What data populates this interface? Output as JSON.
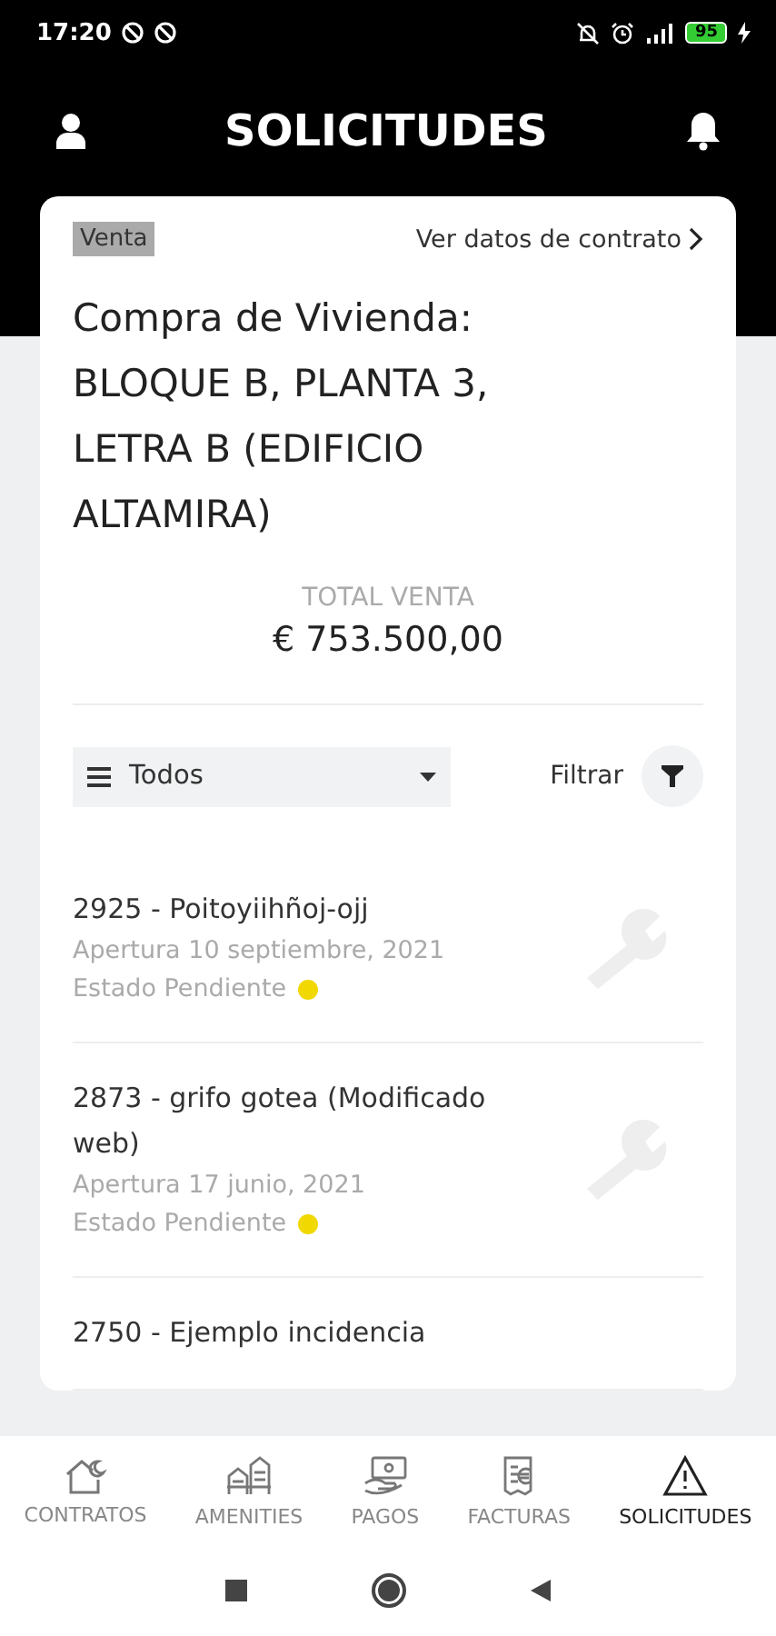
{
  "status_bar": {
    "time": "17:20",
    "battery": "95"
  },
  "header": {
    "title": "SOLICITUDES"
  },
  "contract": {
    "tag": "Venta",
    "link": "Ver datos de contrato",
    "title": "Compra de Vivienda: BLOQUE B, PLANTA 3, LETRA B (EDIFICIO ALTAMIRA)",
    "total_label": "TOTAL VENTA",
    "total": "€ 753.500,00"
  },
  "filter": {
    "dropdown": "Todos",
    "button": "Filtrar"
  },
  "requests": [
    {
      "title": "2925 - Poitoyiihñoj-ojj",
      "opened": "Apertura 10 septiembre, 2021",
      "status": "Estado Pendiente",
      "color": "#f0d800"
    },
    {
      "title": "2873 - grifo gotea (Modificado web)",
      "opened": "Apertura 17 junio, 2021",
      "status": "Estado Pendiente",
      "color": "#f0d800"
    },
    {
      "title": "2750 - Ejemplo incidencia"
    }
  ],
  "tabs": [
    {
      "label": "CONTRATOS",
      "kind": "house",
      "selected": false
    },
    {
      "label": "AMENITIES",
      "kind": "amenities",
      "selected": false
    },
    {
      "label": "PAGOS",
      "kind": "pay",
      "selected": false
    },
    {
      "label": "FACTURAS",
      "kind": "invoice",
      "selected": false
    },
    {
      "label": "SOLICITUDES",
      "kind": "warning",
      "selected": true
    }
  ]
}
